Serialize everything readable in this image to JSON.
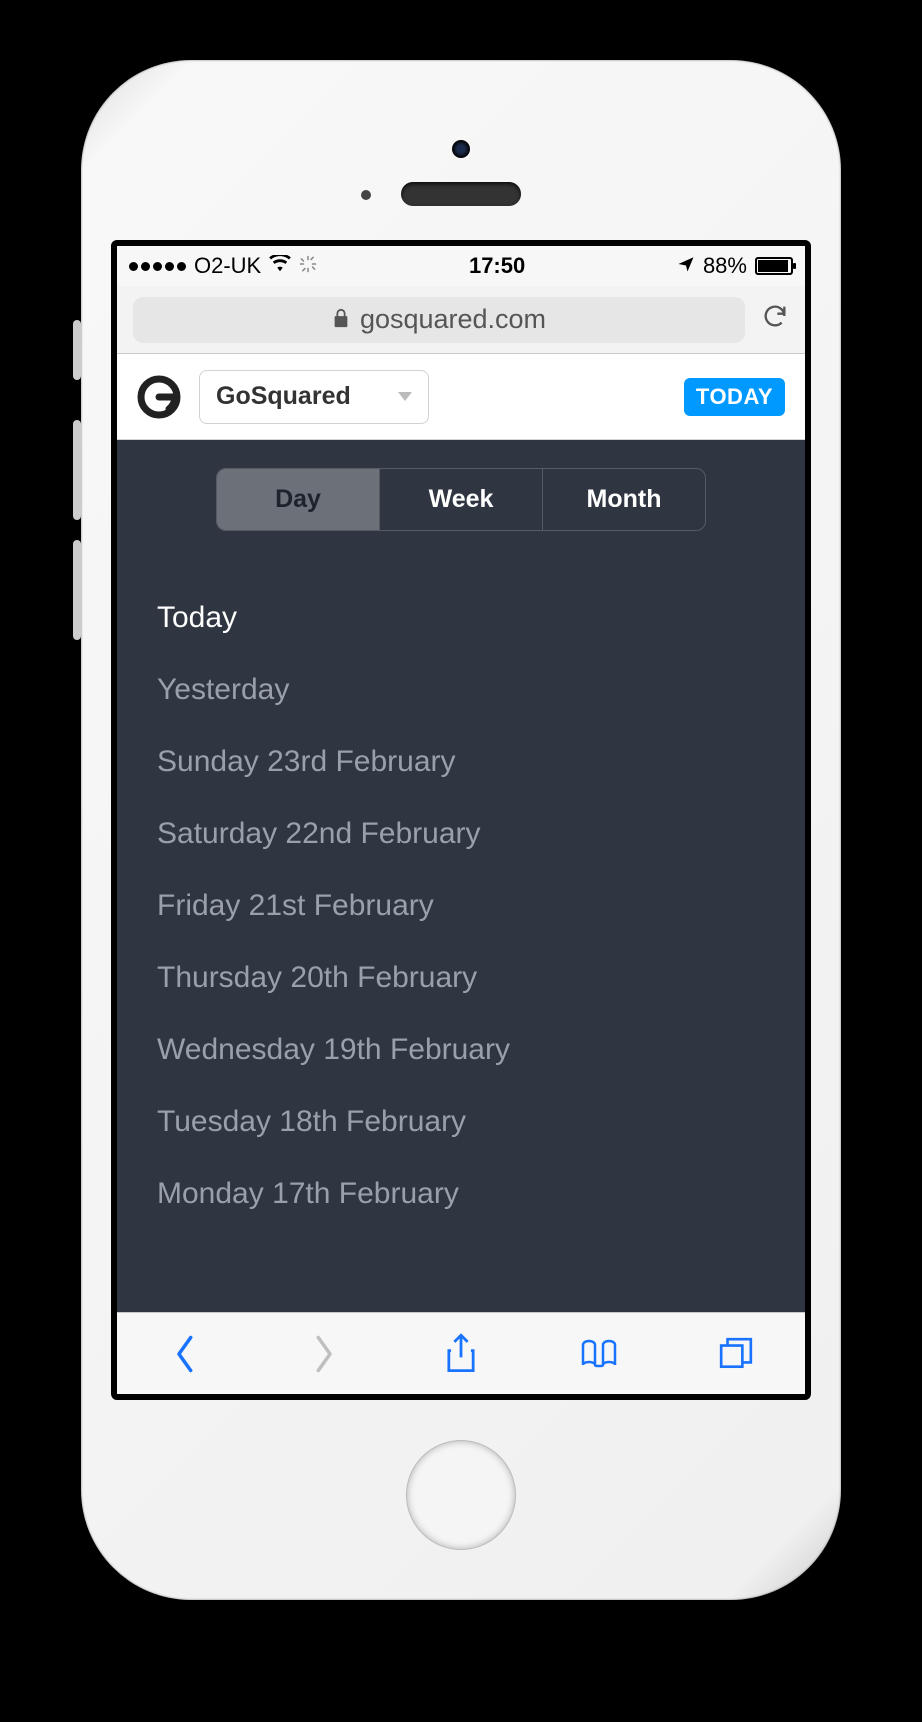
{
  "statusbar": {
    "carrier": "O2-UK",
    "time": "17:50",
    "battery_pct": "88%"
  },
  "browser": {
    "domain": "gosquared.com"
  },
  "app": {
    "site_name": "GoSquared",
    "today_label": "TODAY",
    "segments": {
      "day": "Day",
      "week": "Week",
      "month": "Month"
    },
    "dates": [
      "Today",
      "Yesterday",
      "Sunday 23rd February",
      "Saturday 22nd February",
      "Friday 21st February",
      "Thursday 20th February",
      "Wednesday 19th February",
      "Tuesday 18th February",
      "Monday 17th February"
    ]
  }
}
